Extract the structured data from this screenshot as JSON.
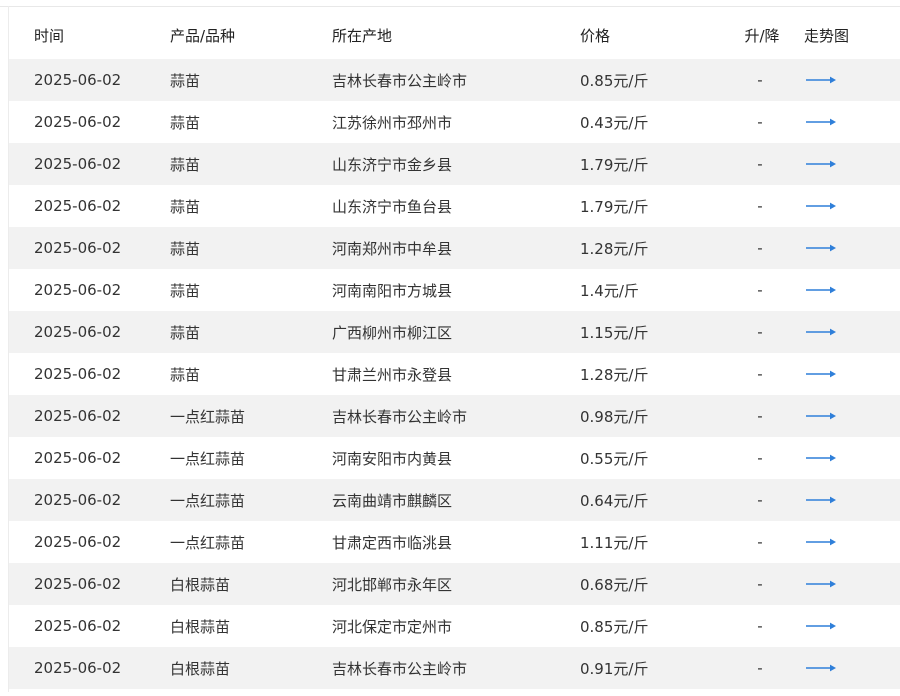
{
  "columns": {
    "date": "时间",
    "product": "产品/品种",
    "origin": "所在产地",
    "price": "价格",
    "change": "升/降",
    "trend": "走势图"
  },
  "accent_color": "#2f7fd9",
  "trend_icon": "arrow-right-icon",
  "rows": [
    {
      "date": "2025-06-02",
      "product": "蒜苗",
      "origin": "吉林长春市公主岭市",
      "price": "0.85元/斤",
      "change": "-"
    },
    {
      "date": "2025-06-02",
      "product": "蒜苗",
      "origin": "江苏徐州市邳州市",
      "price": "0.43元/斤",
      "change": "-"
    },
    {
      "date": "2025-06-02",
      "product": "蒜苗",
      "origin": "山东济宁市金乡县",
      "price": "1.79元/斤",
      "change": "-"
    },
    {
      "date": "2025-06-02",
      "product": "蒜苗",
      "origin": "山东济宁市鱼台县",
      "price": "1.79元/斤",
      "change": "-"
    },
    {
      "date": "2025-06-02",
      "product": "蒜苗",
      "origin": "河南郑州市中牟县",
      "price": "1.28元/斤",
      "change": "-"
    },
    {
      "date": "2025-06-02",
      "product": "蒜苗",
      "origin": "河南南阳市方城县",
      "price": "1.4元/斤",
      "change": "-"
    },
    {
      "date": "2025-06-02",
      "product": "蒜苗",
      "origin": "广西柳州市柳江区",
      "price": "1.15元/斤",
      "change": "-"
    },
    {
      "date": "2025-06-02",
      "product": "蒜苗",
      "origin": "甘肃兰州市永登县",
      "price": "1.28元/斤",
      "change": "-"
    },
    {
      "date": "2025-06-02",
      "product": "一点红蒜苗",
      "origin": "吉林长春市公主岭市",
      "price": "0.98元/斤",
      "change": "-"
    },
    {
      "date": "2025-06-02",
      "product": "一点红蒜苗",
      "origin": "河南安阳市内黄县",
      "price": "0.55元/斤",
      "change": "-"
    },
    {
      "date": "2025-06-02",
      "product": "一点红蒜苗",
      "origin": "云南曲靖市麒麟区",
      "price": "0.64元/斤",
      "change": "-"
    },
    {
      "date": "2025-06-02",
      "product": "一点红蒜苗",
      "origin": "甘肃定西市临洮县",
      "price": "1.11元/斤",
      "change": "-"
    },
    {
      "date": "2025-06-02",
      "product": "白根蒜苗",
      "origin": "河北邯郸市永年区",
      "price": "0.68元/斤",
      "change": "-"
    },
    {
      "date": "2025-06-02",
      "product": "白根蒜苗",
      "origin": "河北保定市定州市",
      "price": "0.85元/斤",
      "change": "-"
    },
    {
      "date": "2025-06-02",
      "product": "白根蒜苗",
      "origin": "吉林长春市公主岭市",
      "price": "0.91元/斤",
      "change": "-"
    }
  ]
}
